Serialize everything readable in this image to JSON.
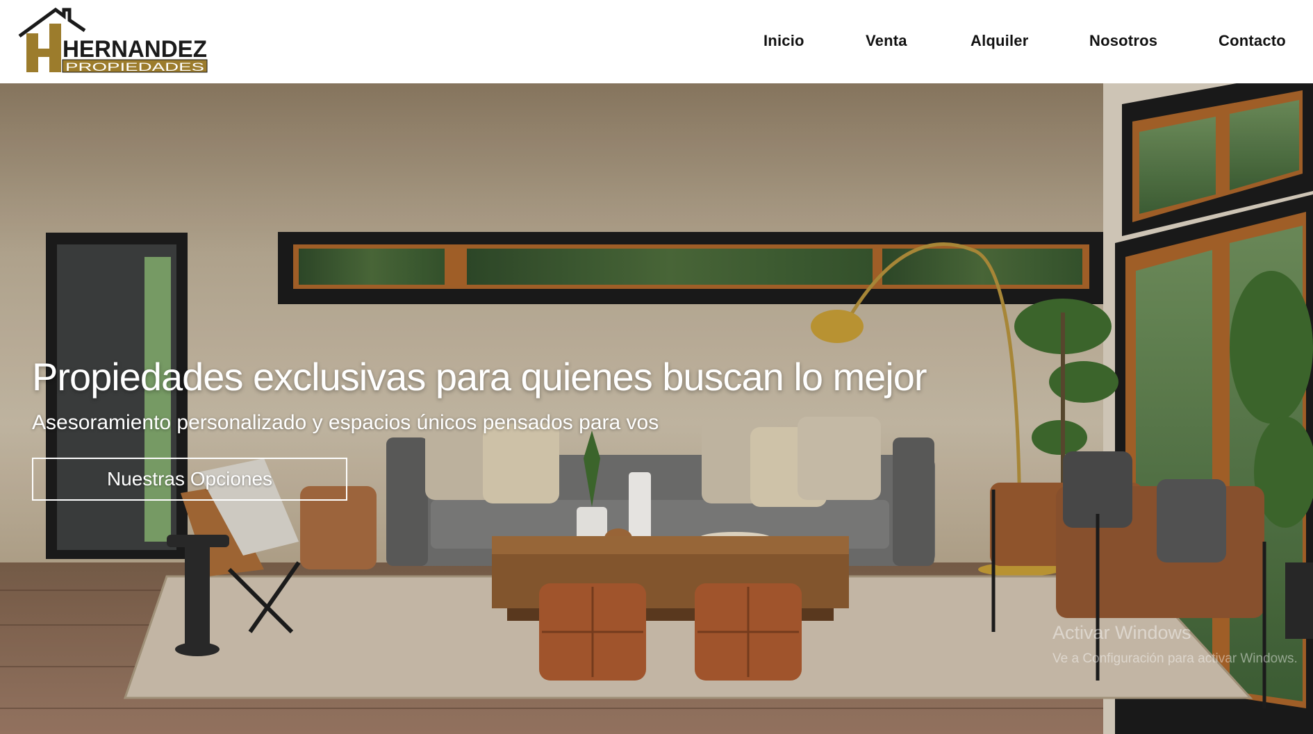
{
  "brand": {
    "name": "HERNANDEZ",
    "subtitle": "PROPIEDADES",
    "letter": "H",
    "colors": {
      "gold": "#9c7c2c",
      "dark": "#1a1a1a"
    }
  },
  "nav": {
    "items": [
      {
        "label": "Inicio"
      },
      {
        "label": "Venta"
      },
      {
        "label": "Alquiler"
      },
      {
        "label": "Nosotros"
      },
      {
        "label": "Contacto"
      }
    ]
  },
  "hero": {
    "title": "Propiedades exclusivas para quienes buscan lo mejor",
    "subtitle": "Asesoramiento personalizado y espacios únicos pensados para vos",
    "button_label": "Nuestras Opciones",
    "image": "living-room-photo"
  },
  "watermark": {
    "line1": "Activar Windows",
    "line2": "Ve a Configuración para activar Windows."
  }
}
